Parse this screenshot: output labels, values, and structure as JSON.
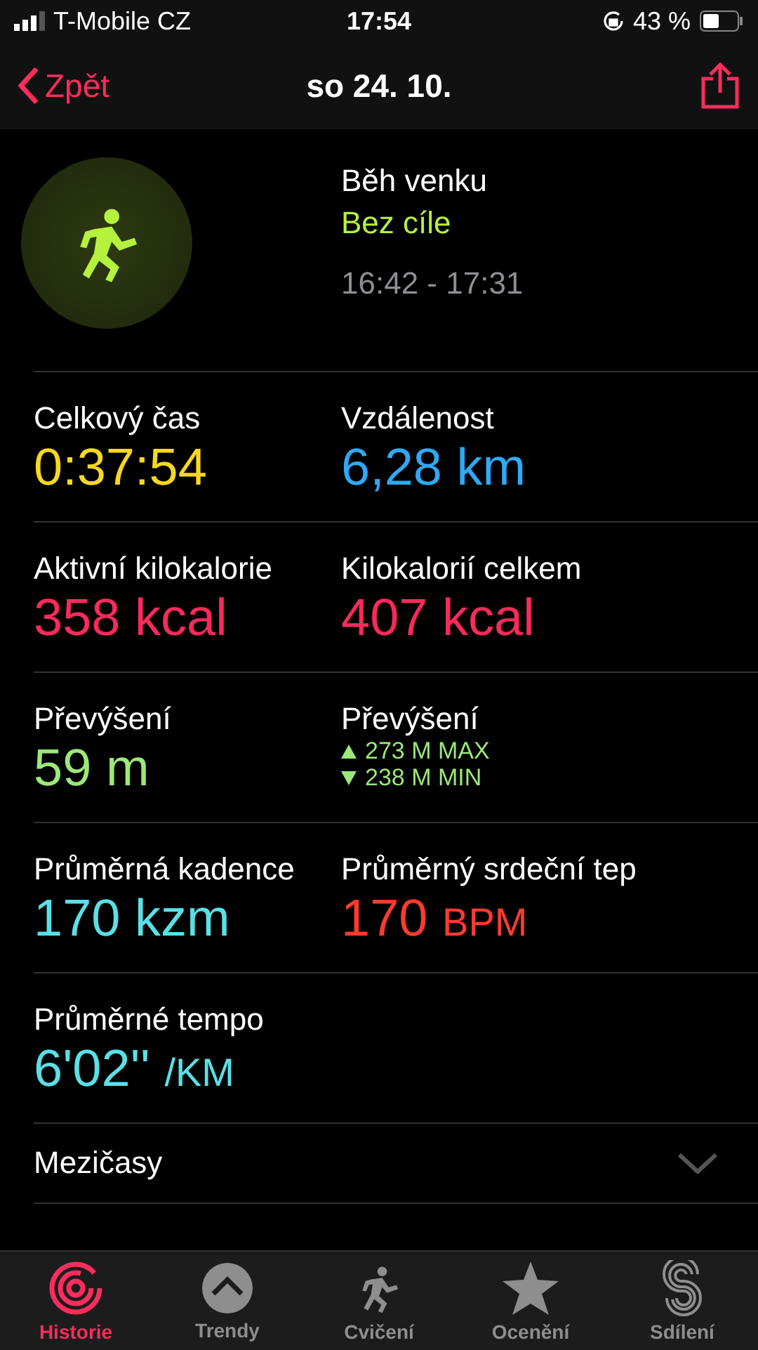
{
  "status_bar": {
    "carrier": "T-Mobile CZ",
    "time": "17:54",
    "battery": "43 %"
  },
  "nav": {
    "back": "Zpět",
    "title": "so 24. 10."
  },
  "workout": {
    "name": "Běh venku",
    "goal": "Bez cíle",
    "time_range": "16:42 - 17:31"
  },
  "metrics": [
    {
      "kind": "value",
      "label": "Celkový čas",
      "value": "0:37:54",
      "color": "#f7d81f"
    },
    {
      "kind": "value",
      "label": "Vzdálenost",
      "value": "6,28",
      "unit": "km",
      "unit_small": false,
      "color": "#2fa9f5"
    },
    {
      "kind": "value",
      "label": "Aktivní kilokalorie",
      "value": "358",
      "unit": "kcal",
      "unit_small": false,
      "color": "#fa2a5a"
    },
    {
      "kind": "value",
      "label": "Kilokalorií celkem",
      "value": "407",
      "unit": "kcal",
      "unit_small": false,
      "color": "#fa2a5a"
    },
    {
      "kind": "value",
      "label": "Převýšení",
      "value": "59",
      "unit": "m",
      "unit_small": false,
      "color": "#9ce87a"
    },
    {
      "kind": "range",
      "label": "Převýšení",
      "lines": [
        {
          "kind": "up",
          "text": "273 M MAX"
        },
        {
          "kind": "down",
          "text": "238 M MIN"
        }
      ],
      "color": "#9ce87a"
    },
    {
      "kind": "value",
      "label": "Průměrná kadence",
      "value": "170",
      "unit": "kzm",
      "unit_small": false,
      "color": "#5ae0e6"
    },
    {
      "kind": "value",
      "label": "Průměrný srdeční tep",
      "value": "170",
      "unit": "BPM",
      "unit_small": true,
      "color": "#ff3b30"
    },
    {
      "kind": "value",
      "label": "Průměrné tempo",
      "value": "6'02''",
      "unit": "/KM",
      "unit_small": true,
      "color": "#5ae0e6"
    }
  ],
  "sections": [
    {
      "label": "Mezičasy",
      "expandable": true
    }
  ],
  "tabs": [
    {
      "label": "Historie",
      "selected": true
    },
    {
      "label": "Trendy",
      "selected": false
    },
    {
      "label": "Cvičení",
      "selected": false
    },
    {
      "label": "Ocenění",
      "selected": false
    },
    {
      "label": "Sdílení",
      "selected": false
    }
  ]
}
